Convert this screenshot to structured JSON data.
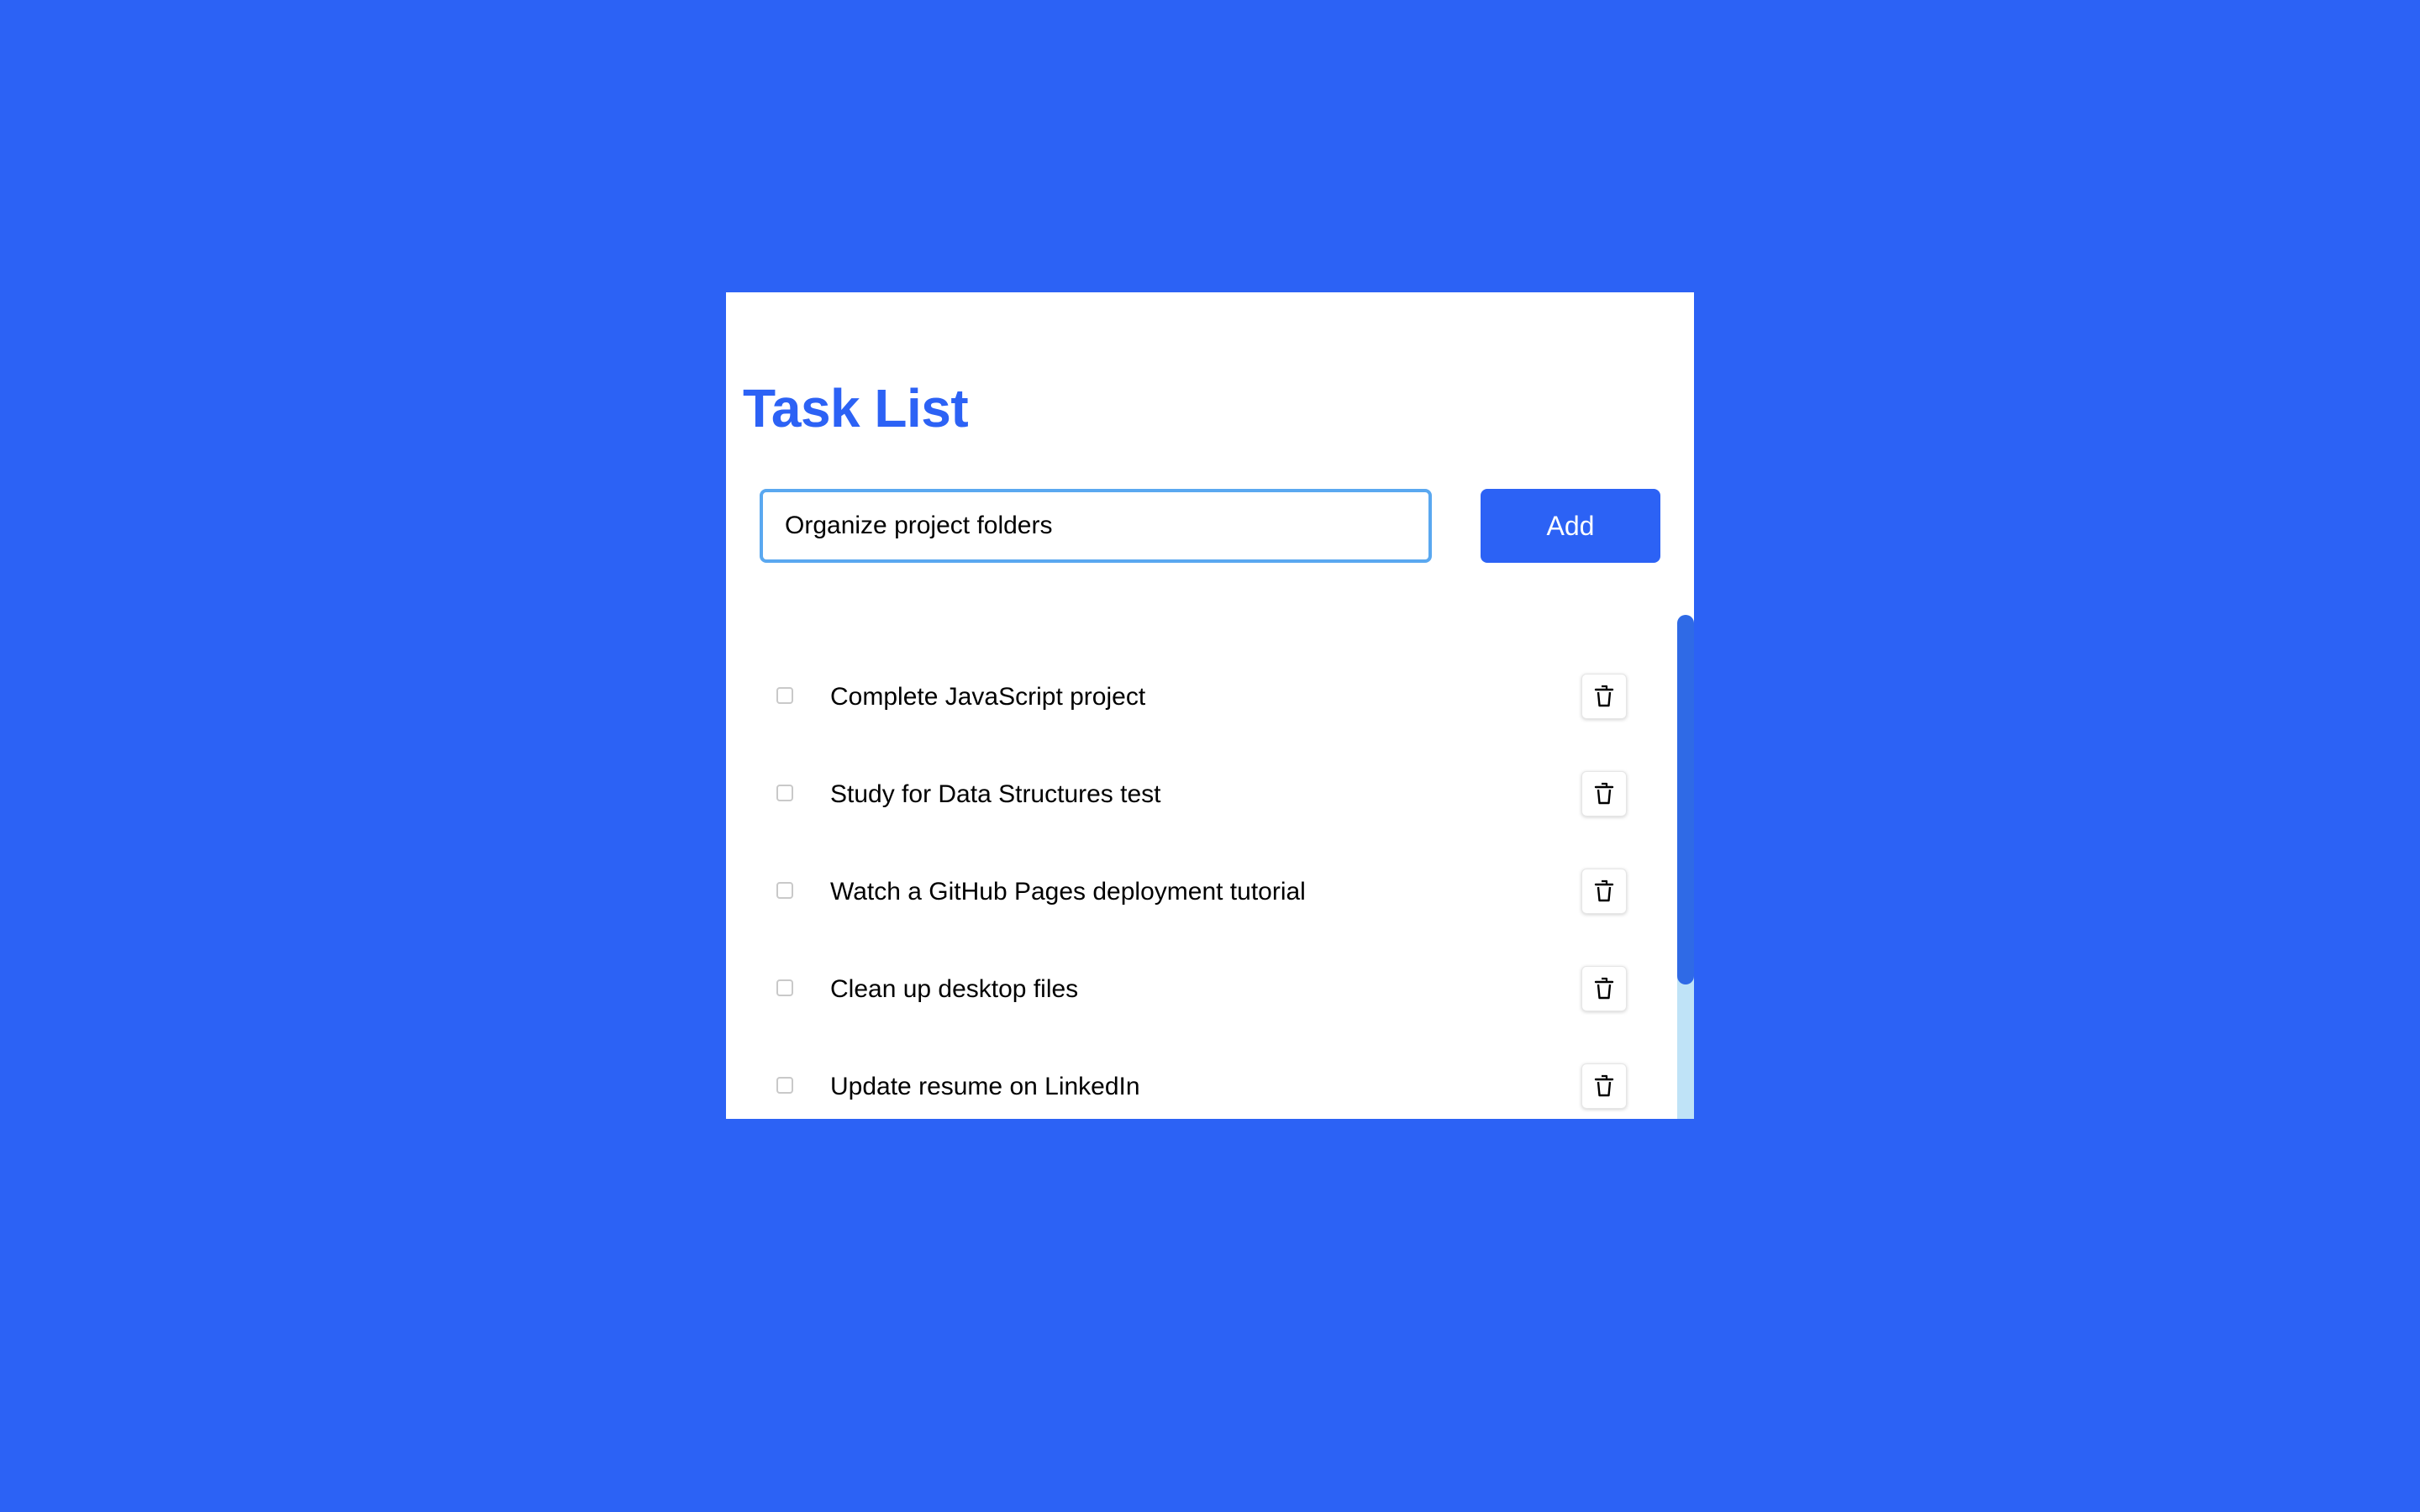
{
  "app": {
    "title": "Task List"
  },
  "input": {
    "value": "Organize project folders",
    "placeholder": ""
  },
  "add_button": {
    "label": "Add"
  },
  "tasks": [
    {
      "label": "Complete JavaScript project",
      "done": false
    },
    {
      "label": "Study for Data Structures test",
      "done": false
    },
    {
      "label": "Watch a GitHub Pages deployment tutorial",
      "done": false
    },
    {
      "label": "Clean up desktop files",
      "done": false
    },
    {
      "label": "Update resume on LinkedIn",
      "done": false
    }
  ],
  "icons": {
    "delete": "trash-icon"
  },
  "colors": {
    "background": "#2c62f5",
    "accent": "#2c62f5",
    "title": "#2c62f5",
    "input_border": "#5aa8f0",
    "scroll_thumb": "#2f6ae6",
    "scroll_track": "#bfe3f7"
  }
}
